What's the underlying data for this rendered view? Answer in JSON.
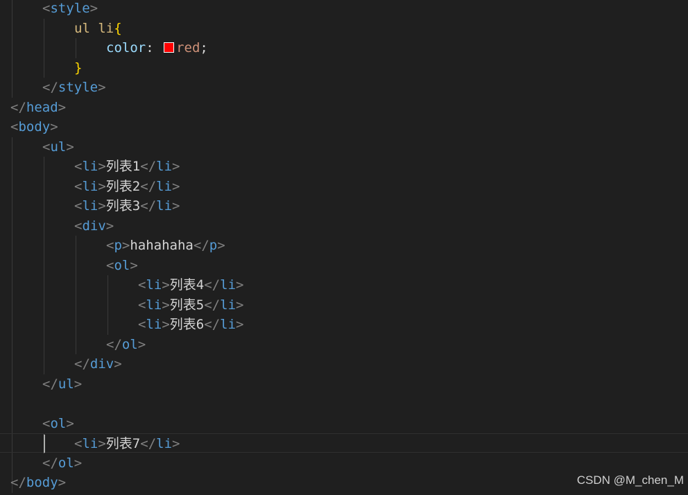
{
  "editor": {
    "colors": {
      "background": "#1f1f1f",
      "tag": "#569cd6",
      "punctuation": "#808080",
      "selector": "#d7ba7d",
      "property": "#9cdcfe",
      "value": "#ce9178",
      "brace": "#ffd700",
      "text": "#d4d4d4",
      "swatch": "#ff0000"
    },
    "lines": [
      [
        {
          "t": "<",
          "c": "punct"
        },
        {
          "t": "style",
          "c": "tag"
        },
        {
          "t": ">",
          "c": "punct"
        }
      ],
      [
        {
          "t": "ul li",
          "c": "selector"
        },
        {
          "t": "{",
          "c": "brace"
        }
      ],
      [
        {
          "t": "color",
          "c": "prop"
        },
        {
          "t": ": ",
          "c": "text"
        },
        {
          "t": "",
          "c": "swatch"
        },
        {
          "t": "red",
          "c": "value"
        },
        {
          "t": ";",
          "c": "text"
        }
      ],
      [
        {
          "t": "}",
          "c": "brace"
        }
      ],
      [
        {
          "t": "</",
          "c": "punct"
        },
        {
          "t": "style",
          "c": "tag"
        },
        {
          "t": ">",
          "c": "punct"
        }
      ],
      [
        {
          "t": "</",
          "c": "punct"
        },
        {
          "t": "head",
          "c": "tag"
        },
        {
          "t": ">",
          "c": "punct"
        }
      ],
      [
        {
          "t": "<",
          "c": "punct"
        },
        {
          "t": "body",
          "c": "tag"
        },
        {
          "t": ">",
          "c": "punct"
        }
      ],
      [
        {
          "t": "<",
          "c": "punct"
        },
        {
          "t": "ul",
          "c": "tag"
        },
        {
          "t": ">",
          "c": "punct"
        }
      ],
      [
        {
          "t": "<",
          "c": "punct"
        },
        {
          "t": "li",
          "c": "tag"
        },
        {
          "t": ">",
          "c": "punct"
        },
        {
          "t": "列表1",
          "c": "text"
        },
        {
          "t": "</",
          "c": "punct"
        },
        {
          "t": "li",
          "c": "tag"
        },
        {
          "t": ">",
          "c": "punct"
        }
      ],
      [
        {
          "t": "<",
          "c": "punct"
        },
        {
          "t": "li",
          "c": "tag"
        },
        {
          "t": ">",
          "c": "punct"
        },
        {
          "t": "列表2",
          "c": "text"
        },
        {
          "t": "</",
          "c": "punct"
        },
        {
          "t": "li",
          "c": "tag"
        },
        {
          "t": ">",
          "c": "punct"
        }
      ],
      [
        {
          "t": "<",
          "c": "punct"
        },
        {
          "t": "li",
          "c": "tag"
        },
        {
          "t": ">",
          "c": "punct"
        },
        {
          "t": "列表3",
          "c": "text"
        },
        {
          "t": "</",
          "c": "punct"
        },
        {
          "t": "li",
          "c": "tag"
        },
        {
          "t": ">",
          "c": "punct"
        }
      ],
      [
        {
          "t": "<",
          "c": "punct"
        },
        {
          "t": "div",
          "c": "tag"
        },
        {
          "t": ">",
          "c": "punct"
        }
      ],
      [
        {
          "t": "<",
          "c": "punct"
        },
        {
          "t": "p",
          "c": "tag"
        },
        {
          "t": ">",
          "c": "punct"
        },
        {
          "t": "hahahaha",
          "c": "text"
        },
        {
          "t": "</",
          "c": "punct"
        },
        {
          "t": "p",
          "c": "tag"
        },
        {
          "t": ">",
          "c": "punct"
        }
      ],
      [
        {
          "t": "<",
          "c": "punct"
        },
        {
          "t": "ol",
          "c": "tag"
        },
        {
          "t": ">",
          "c": "punct"
        }
      ],
      [
        {
          "t": "<",
          "c": "punct"
        },
        {
          "t": "li",
          "c": "tag"
        },
        {
          "t": ">",
          "c": "punct"
        },
        {
          "t": "列表4",
          "c": "text"
        },
        {
          "t": "</",
          "c": "punct"
        },
        {
          "t": "li",
          "c": "tag"
        },
        {
          "t": ">",
          "c": "punct"
        }
      ],
      [
        {
          "t": "<",
          "c": "punct"
        },
        {
          "t": "li",
          "c": "tag"
        },
        {
          "t": ">",
          "c": "punct"
        },
        {
          "t": "列表5",
          "c": "text"
        },
        {
          "t": "</",
          "c": "punct"
        },
        {
          "t": "li",
          "c": "tag"
        },
        {
          "t": ">",
          "c": "punct"
        }
      ],
      [
        {
          "t": "<",
          "c": "punct"
        },
        {
          "t": "li",
          "c": "tag"
        },
        {
          "t": ">",
          "c": "punct"
        },
        {
          "t": "列表6",
          "c": "text"
        },
        {
          "t": "</",
          "c": "punct"
        },
        {
          "t": "li",
          "c": "tag"
        },
        {
          "t": ">",
          "c": "punct"
        }
      ],
      [
        {
          "t": "</",
          "c": "punct"
        },
        {
          "t": "ol",
          "c": "tag"
        },
        {
          "t": ">",
          "c": "punct"
        }
      ],
      [
        {
          "t": "</",
          "c": "punct"
        },
        {
          "t": "div",
          "c": "tag"
        },
        {
          "t": ">",
          "c": "punct"
        }
      ],
      [
        {
          "t": "</",
          "c": "punct"
        },
        {
          "t": "ul",
          "c": "tag"
        },
        {
          "t": ">",
          "c": "punct"
        }
      ],
      [],
      [
        {
          "t": "<",
          "c": "punct"
        },
        {
          "t": "ol",
          "c": "tag"
        },
        {
          "t": ">",
          "c": "punct"
        }
      ],
      [
        {
          "t": "<",
          "c": "punct"
        },
        {
          "t": "li",
          "c": "tag"
        },
        {
          "t": ">",
          "c": "punct"
        },
        {
          "t": "列表7",
          "c": "text"
        },
        {
          "t": "</",
          "c": "punct"
        },
        {
          "t": "li",
          "c": "tag"
        },
        {
          "t": ">",
          "c": "punct"
        }
      ],
      [
        {
          "t": "</",
          "c": "punct"
        },
        {
          "t": "ol",
          "c": "tag"
        },
        {
          "t": ">",
          "c": "punct"
        }
      ],
      [
        {
          "t": "</",
          "c": "punct"
        },
        {
          "t": "body",
          "c": "tag"
        },
        {
          "t": ">",
          "c": "punct"
        }
      ]
    ]
  },
  "watermark": {
    "text": "CSDN @M_chen_M"
  }
}
